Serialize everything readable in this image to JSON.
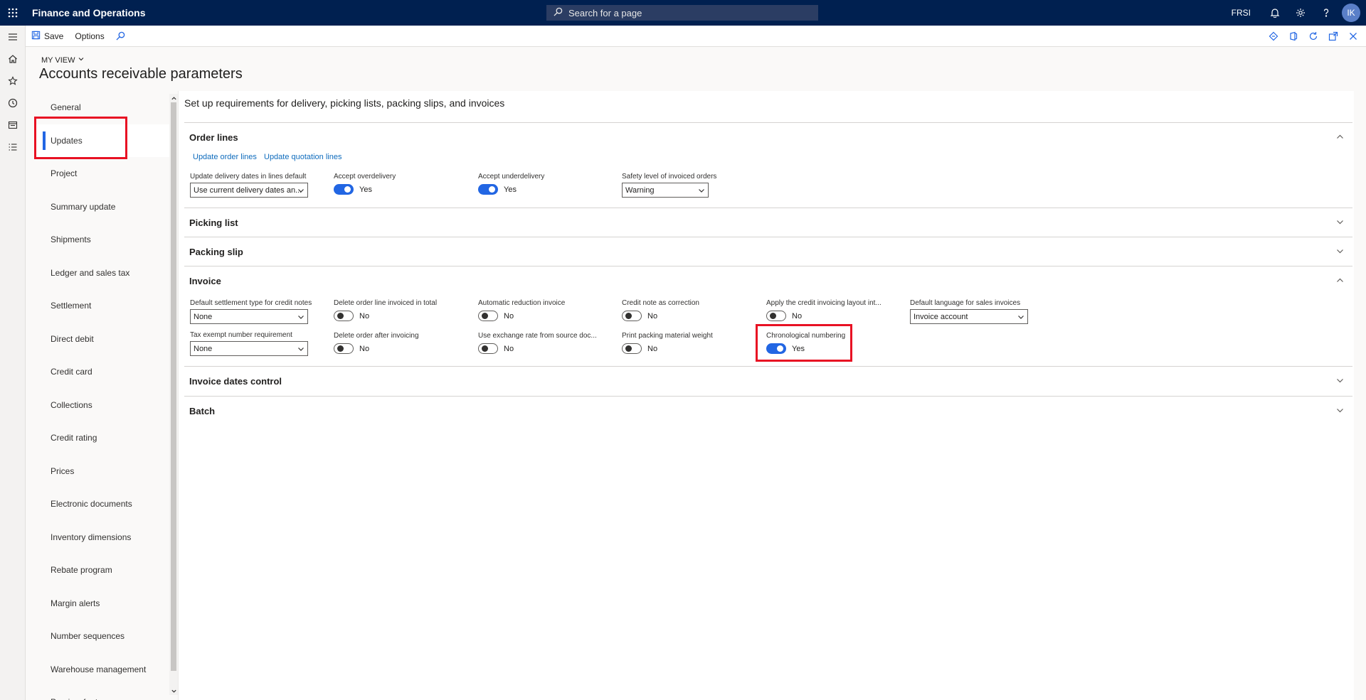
{
  "app": {
    "title": "Finance and Operations"
  },
  "search": {
    "placeholder": "Search for a page"
  },
  "topbar": {
    "company": "FRSI",
    "avatar_initials": "IK"
  },
  "actionpane": {
    "save_label": "Save",
    "options_label": "Options"
  },
  "page": {
    "view_label": "MY VIEW",
    "title": "Accounts receivable parameters"
  },
  "tabs": [
    {
      "label": "General"
    },
    {
      "label": "Updates",
      "active": true
    },
    {
      "label": "Project"
    },
    {
      "label": "Summary update"
    },
    {
      "label": "Shipments"
    },
    {
      "label": "Ledger and sales tax"
    },
    {
      "label": "Settlement"
    },
    {
      "label": "Direct debit"
    },
    {
      "label": "Credit card"
    },
    {
      "label": "Collections"
    },
    {
      "label": "Credit rating"
    },
    {
      "label": "Prices"
    },
    {
      "label": "Electronic documents"
    },
    {
      "label": "Inventory dimensions"
    },
    {
      "label": "Rebate program"
    },
    {
      "label": "Margin alerts"
    },
    {
      "label": "Number sequences"
    },
    {
      "label": "Warehouse management"
    },
    {
      "label": "Preview features"
    }
  ],
  "content": {
    "title": "Set up requirements for delivery, picking lists, packing slips, and invoices",
    "order_lines": {
      "title": "Order lines",
      "link_update_order_lines": "Update order lines",
      "link_update_quotation_lines": "Update quotation lines",
      "update_delivery_dates": {
        "label": "Update delivery dates in lines default",
        "value": "Use current delivery dates an..."
      },
      "accept_overdelivery": {
        "label": "Accept overdelivery",
        "value": "Yes",
        "on": true
      },
      "accept_underdelivery": {
        "label": "Accept underdelivery",
        "value": "Yes",
        "on": true
      },
      "safety_level": {
        "label": "Safety level of invoiced orders",
        "value": "Warning"
      }
    },
    "picking_list": {
      "title": "Picking list"
    },
    "packing_slip": {
      "title": "Packing slip"
    },
    "invoice": {
      "title": "Invoice",
      "default_settlement_type": {
        "label": "Default settlement type for credit notes",
        "value": "None"
      },
      "delete_order_line": {
        "label": "Delete order line invoiced in total",
        "value": "No",
        "on": false
      },
      "automatic_reduction": {
        "label": "Automatic reduction invoice",
        "value": "No",
        "on": false
      },
      "credit_note_correction": {
        "label": "Credit note as correction",
        "value": "No",
        "on": false
      },
      "apply_credit_layout": {
        "label": "Apply the credit invoicing layout int...",
        "value": "No",
        "on": false
      },
      "default_language": {
        "label": "Default language for sales invoices",
        "value": "Invoice account"
      },
      "tax_exempt": {
        "label": "Tax exempt number requirement",
        "value": "None"
      },
      "delete_order_after": {
        "label": "Delete order after invoicing",
        "value": "No",
        "on": false
      },
      "use_exchange_rate": {
        "label": "Use exchange rate from source doc...",
        "value": "No",
        "on": false
      },
      "print_packing_weight": {
        "label": "Print packing material weight",
        "value": "No",
        "on": false
      },
      "chronological_numbering": {
        "label": "Chronological numbering",
        "value": "Yes",
        "on": true
      }
    },
    "invoice_dates_control": {
      "title": "Invoice dates control"
    },
    "batch": {
      "title": "Batch"
    }
  },
  "colors": {
    "nav_bg": "#002050",
    "accent": "#2266e3",
    "highlight": "#e81123"
  }
}
